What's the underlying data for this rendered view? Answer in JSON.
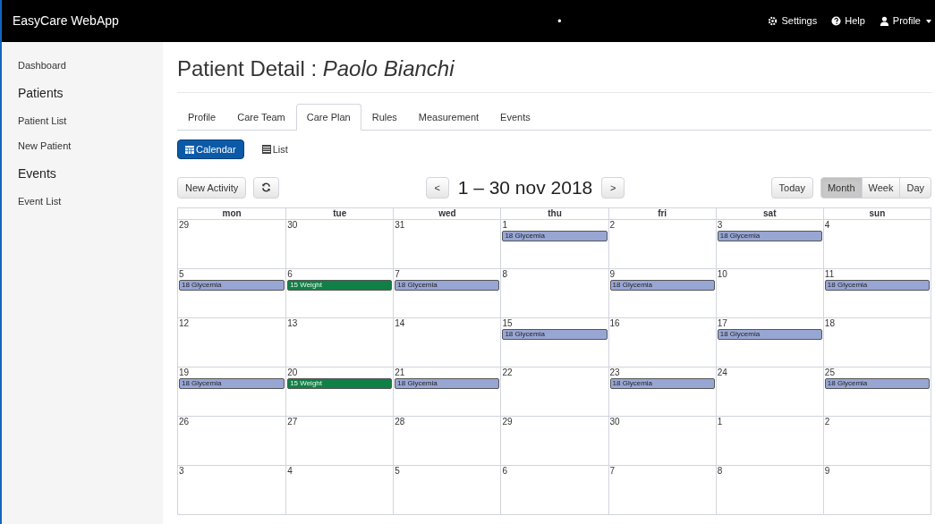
{
  "navbar": {
    "brand": "EasyCare WebApp",
    "dot": "•",
    "links": [
      {
        "kind": "settings",
        "label": "Settings"
      },
      {
        "kind": "help",
        "label": "Help"
      },
      {
        "kind": "profile",
        "label": "Profile",
        "caret": true
      }
    ]
  },
  "sidebar": {
    "items": [
      {
        "label": "Dashboard",
        "kind": "link"
      },
      {
        "label": "Patients",
        "kind": "heading"
      },
      {
        "label": "Patient List",
        "kind": "link"
      },
      {
        "label": "New Patient",
        "kind": "link"
      },
      {
        "label": "Events",
        "kind": "heading"
      },
      {
        "label": "Event List",
        "kind": "link"
      }
    ]
  },
  "page_title": {
    "prefix": "Patient Detail : ",
    "name": "Paolo Bianchi"
  },
  "tabs": [
    {
      "label": "Profile",
      "selected": false
    },
    {
      "label": "Care Team",
      "selected": false
    },
    {
      "label": "Care Plan",
      "selected": true
    },
    {
      "label": "Rules",
      "selected": false
    },
    {
      "label": "Measurement",
      "selected": false
    },
    {
      "label": "Events",
      "selected": false
    }
  ],
  "view_toggle": [
    {
      "label": "Calendar",
      "selected": true
    },
    {
      "label": "List",
      "selected": false
    }
  ],
  "toolbar": {
    "new_button": "New Activity",
    "prev": "<",
    "title": "1 – 30 nov 2018",
    "next": ">",
    "today": "Today",
    "views": [
      {
        "label": "Month",
        "selected": true
      },
      {
        "label": "Week",
        "selected": false
      },
      {
        "label": "Day",
        "selected": false
      }
    ]
  },
  "calendar": {
    "columns": [
      "mon",
      "tue",
      "wed",
      "thu",
      "fri",
      "sat",
      "sun"
    ],
    "weeks": [
      [
        {
          "day": "29"
        },
        {
          "day": "30"
        },
        {
          "day": "31"
        },
        {
          "day": "1",
          "events": [
            {
              "label": "18 Glycemia",
              "color": "#98a6d4"
            }
          ]
        },
        {
          "day": "2"
        },
        {
          "day": "3",
          "events": [
            {
              "label": "18 Glycemia",
              "color": "#98a6d4"
            }
          ]
        },
        {
          "day": "4"
        }
      ],
      [
        {
          "day": "5",
          "events": [
            {
              "label": "18 Glycemia",
              "color": "#98a6d4"
            }
          ]
        },
        {
          "day": "6",
          "events": [
            {
              "label": "15 Weight",
              "color": "#118046"
            }
          ]
        },
        {
          "day": "7",
          "events": [
            {
              "label": "18 Glycemia",
              "color": "#98a6d4"
            }
          ]
        },
        {
          "day": "8"
        },
        {
          "day": "9",
          "events": [
            {
              "label": "18 Glycemia",
              "color": "#98a6d4"
            }
          ]
        },
        {
          "day": "10"
        },
        {
          "day": "11",
          "events": [
            {
              "label": "18 Glycemia",
              "color": "#98a6d4"
            }
          ]
        }
      ],
      [
        {
          "day": "12"
        },
        {
          "day": "13"
        },
        {
          "day": "14"
        },
        {
          "day": "15",
          "events": [
            {
              "label": "18 Glycemia",
              "color": "#98a6d4"
            }
          ]
        },
        {
          "day": "16"
        },
        {
          "day": "17",
          "events": [
            {
              "label": "18 Glycemia",
              "color": "#98a6d4"
            }
          ]
        },
        {
          "day": "18"
        }
      ],
      [
        {
          "day": "19",
          "events": [
            {
              "label": "18 Glycemia",
              "color": "#98a6d4"
            }
          ]
        },
        {
          "day": "20",
          "events": [
            {
              "label": "15 Weight",
              "color": "#118046"
            }
          ]
        },
        {
          "day": "21",
          "events": [
            {
              "label": "18 Glycemia",
              "color": "#98a6d4"
            }
          ]
        },
        {
          "day": "22"
        },
        {
          "day": "23",
          "events": [
            {
              "label": "18 Glycemia",
              "color": "#98a6d4"
            }
          ]
        },
        {
          "day": "24"
        },
        {
          "day": "25",
          "events": [
            {
              "label": "18 Glycemia",
              "color": "#98a6d4"
            }
          ]
        }
      ],
      [
        {
          "day": "26"
        },
        {
          "day": "27"
        },
        {
          "day": "28"
        },
        {
          "day": "29"
        },
        {
          "day": "30"
        },
        {
          "day": "1"
        },
        {
          "day": "2"
        }
      ],
      [
        {
          "day": "3"
        },
        {
          "day": "4"
        },
        {
          "day": "5"
        },
        {
          "day": "6"
        },
        {
          "day": "7"
        },
        {
          "day": "8"
        },
        {
          "day": "9"
        }
      ]
    ]
  }
}
